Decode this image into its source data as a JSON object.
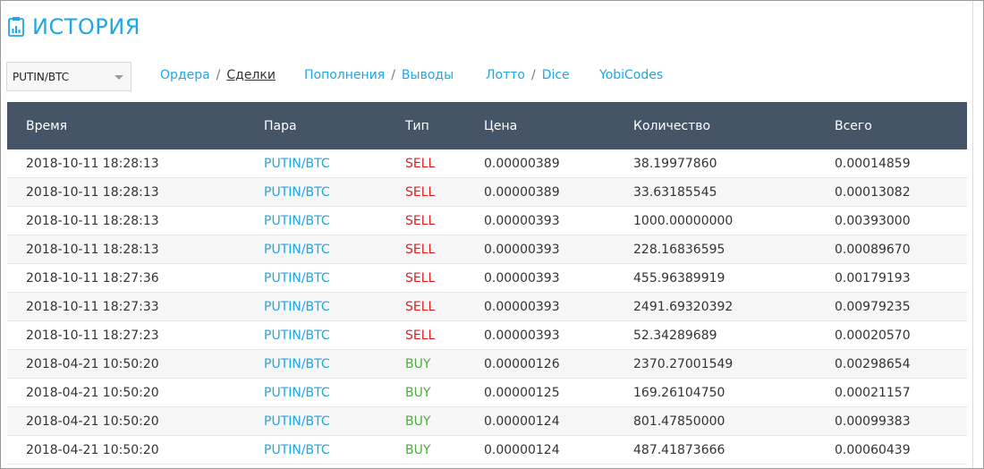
{
  "page": {
    "title": "ИСТОРИЯ"
  },
  "pair_select": {
    "value": "PUTIN/BTC"
  },
  "nav": [
    {
      "label": "Ордера",
      "active": false
    },
    {
      "label": "Сделки",
      "active": true
    },
    {
      "label": "Пополнения",
      "active": false
    },
    {
      "label": "Выводы",
      "active": false
    },
    {
      "label": "Лотто",
      "active": false
    },
    {
      "label": "Dice",
      "active": false
    },
    {
      "label": "YobiCodes",
      "active": false
    }
  ],
  "table": {
    "headers": [
      "Время",
      "Пара",
      "Тип",
      "Цена",
      "Количество",
      "Всего"
    ],
    "rows": [
      [
        "2018-10-11 18:28:13",
        "PUTIN/BTC",
        "SELL",
        "0.00000389",
        "38.19977860",
        "0.00014859"
      ],
      [
        "2018-10-11 18:28:13",
        "PUTIN/BTC",
        "SELL",
        "0.00000389",
        "33.63185545",
        "0.00013082"
      ],
      [
        "2018-10-11 18:28:13",
        "PUTIN/BTC",
        "SELL",
        "0.00000393",
        "1000.00000000",
        "0.00393000"
      ],
      [
        "2018-10-11 18:28:13",
        "PUTIN/BTC",
        "SELL",
        "0.00000393",
        "228.16836595",
        "0.00089670"
      ],
      [
        "2018-10-11 18:27:36",
        "PUTIN/BTC",
        "SELL",
        "0.00000393",
        "455.96389919",
        "0.00179193"
      ],
      [
        "2018-10-11 18:27:33",
        "PUTIN/BTC",
        "SELL",
        "0.00000393",
        "2491.69320392",
        "0.00979235"
      ],
      [
        "2018-10-11 18:27:23",
        "PUTIN/BTC",
        "SELL",
        "0.00000393",
        "52.34289689",
        "0.00020570"
      ],
      [
        "2018-04-21 10:50:20",
        "PUTIN/BTC",
        "BUY",
        "0.00000126",
        "2370.27001549",
        "0.00298654"
      ],
      [
        "2018-04-21 10:50:20",
        "PUTIN/BTC",
        "BUY",
        "0.00000125",
        "169.26104750",
        "0.00021157"
      ],
      [
        "2018-04-21 10:50:20",
        "PUTIN/BTC",
        "BUY",
        "0.00000124",
        "801.47850000",
        "0.00099383"
      ],
      [
        "2018-04-21 10:50:20",
        "PUTIN/BTC",
        "BUY",
        "0.00000124",
        "487.41873666",
        "0.00060439"
      ]
    ]
  },
  "colors": {
    "accent": "#1ea7e4",
    "header_bg": "#465468",
    "sell": "#e02020",
    "buy": "#4aaf3a"
  }
}
